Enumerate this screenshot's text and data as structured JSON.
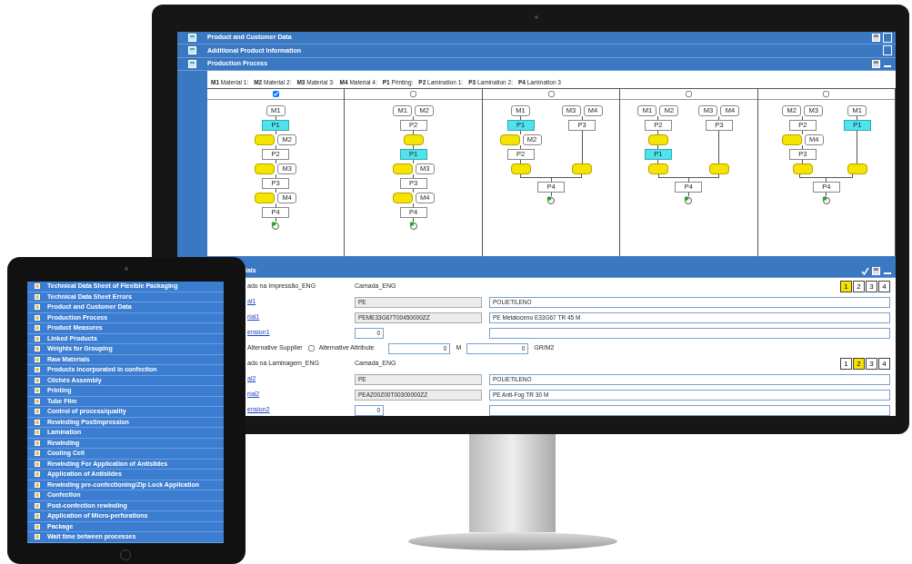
{
  "sections": [
    {
      "title": "Product and Customer Data",
      "expanded": false,
      "savable": true
    },
    {
      "title": "Additional Product Information",
      "expanded": false,
      "savable": false
    },
    {
      "title": "Production Process",
      "expanded": true,
      "savable": true
    }
  ],
  "legend": [
    {
      "code": "M1",
      "name": "Material 1:"
    },
    {
      "code": "M2",
      "name": "Material 2:"
    },
    {
      "code": "M3",
      "name": "Material 3:"
    },
    {
      "code": "M4",
      "name": "Material 4:"
    },
    {
      "code": "P1",
      "name": "Printing:"
    },
    {
      "code": "P2",
      "name": "Lamination 1:"
    },
    {
      "code": "P3",
      "name": "Lamination 2:"
    },
    {
      "code": "P4",
      "name": "Lamination 3"
    }
  ],
  "diagrams": [
    {
      "checked": true,
      "branches": [
        {
          "materials": [
            "M1"
          ],
          "steps": [
            {
              "kind": "printing",
              "label": "P1"
            },
            {
              "kind": "coil",
              "side": "M2"
            },
            {
              "kind": "lamination",
              "label": "P2"
            },
            {
              "kind": "coil",
              "side": "M3"
            },
            {
              "kind": "lamination",
              "label": "P3"
            },
            {
              "kind": "coil",
              "side": "M4"
            },
            {
              "kind": "lamination",
              "label": "P4"
            }
          ]
        }
      ]
    },
    {
      "checked": false,
      "branches": [
        {
          "materials": [
            "M1",
            "M2"
          ],
          "steps": [
            {
              "kind": "lamination",
              "label": "P2"
            },
            {
              "kind": "coil"
            },
            {
              "kind": "printing",
              "label": "P1"
            },
            {
              "kind": "coil",
              "side": "M3"
            },
            {
              "kind": "lamination",
              "label": "P3"
            },
            {
              "kind": "coil",
              "side": "M4"
            },
            {
              "kind": "lamination",
              "label": "P4"
            }
          ]
        }
      ]
    },
    {
      "checked": false,
      "branches": [
        {
          "materials": [
            "M1"
          ],
          "steps": [
            {
              "kind": "printing",
              "label": "P1"
            },
            {
              "kind": "coil",
              "side": "M2"
            },
            {
              "kind": "lamination",
              "label": "P2"
            },
            {
              "kind": "coil"
            }
          ]
        },
        {
          "materials": [
            "M3",
            "M4"
          ],
          "steps": [
            {
              "kind": "lamination",
              "label": "P3"
            },
            {
              "kind": "coil"
            }
          ]
        }
      ],
      "merge": "P4"
    },
    {
      "checked": false,
      "branches": [
        {
          "materials": [
            "M1",
            "M2"
          ],
          "steps": [
            {
              "kind": "lamination",
              "label": "P2"
            },
            {
              "kind": "coil"
            },
            {
              "kind": "printing",
              "label": "P1"
            },
            {
              "kind": "coil"
            }
          ]
        },
        {
          "materials": [
            "M3",
            "M4"
          ],
          "steps": [
            {
              "kind": "lamination",
              "label": "P3"
            },
            {
              "kind": "coil"
            }
          ]
        }
      ],
      "merge": "P4"
    },
    {
      "checked": false,
      "branches": [
        {
          "materials": [
            "M2",
            "M3"
          ],
          "steps": [
            {
              "kind": "lamination",
              "label": "P2"
            },
            {
              "kind": "coil",
              "side": "M4"
            },
            {
              "kind": "lamination",
              "label": "P3"
            },
            {
              "kind": "coil"
            }
          ]
        },
        {
          "materials": [
            "M1"
          ],
          "steps": [
            {
              "kind": "printing",
              "label": "P1"
            },
            {
              "kind": "coil"
            }
          ]
        }
      ],
      "merge": "P4"
    }
  ],
  "materials_section": {
    "title": "ials",
    "expanded": true,
    "savable": true,
    "rows": [
      {
        "kind": "layer",
        "label": "ado na Impressão_ENG",
        "value": "Camada_ENG",
        "pages": [
          {
            "label": "1",
            "selected": true
          },
          {
            "label": "2",
            "selected": false
          },
          {
            "label": "3",
            "selected": false
          },
          {
            "label": "4",
            "selected": false
          }
        ]
      },
      {
        "kind": "pair",
        "link": "al1",
        "code": {
          "value": "PE",
          "readonly": true
        },
        "name": {
          "value": "POLIETILENO",
          "readonly": false
        }
      },
      {
        "kind": "pair",
        "link": "rial1",
        "code": {
          "value": "PEME33G67T00450000ZZ",
          "readonly": true
        },
        "name": {
          "value": "PE Metaloceno E33G67 TR 45 M",
          "readonly": false
        }
      },
      {
        "kind": "dimension",
        "link": "ension1",
        "value": "0"
      },
      {
        "kind": "options",
        "label": "Alternative Supplier",
        "checkbox": {
          "label": "Alternative Attribute",
          "checked": false
        },
        "fields": [
          {
            "value": "0",
            "unit": "M"
          },
          {
            "value": "0",
            "unit": "GR/M2"
          }
        ]
      },
      {
        "kind": "layer",
        "label": "ado na Laminagem_ENG",
        "value": "Camada_ENG",
        "pages": [
          {
            "label": "1",
            "selected": false
          },
          {
            "label": "2",
            "selected": true
          },
          {
            "label": "3",
            "selected": false
          },
          {
            "label": "4",
            "selected": false
          }
        ]
      },
      {
        "kind": "pair",
        "link": "al2",
        "code": {
          "value": "PE",
          "readonly": true
        },
        "name": {
          "value": "POLIETILENO",
          "readonly": false
        }
      },
      {
        "kind": "pair",
        "link": "rial2",
        "code": {
          "value": "PEAZ00Z00T00300000ZZ",
          "readonly": true
        },
        "name": {
          "value": "PE Anti-Fog TR 30 M",
          "readonly": false
        }
      },
      {
        "kind": "dimension",
        "link": "ension2",
        "value": "0"
      }
    ]
  },
  "tablet_menu": [
    "Technical Data Sheet of Flexible Packaging",
    "Technical Data Sheet Errors",
    "Product and Customer Data",
    "Production Process",
    "Product Measures",
    "Linked Products",
    "Weights for Grouping",
    "Raw Materials",
    "Products incorporated in confection",
    "Clichés Assembly",
    "Printing",
    "Tube Film",
    "Control of process/quality",
    "Rewinding Postimpression",
    "Lamination",
    "Rewinding",
    "Cooling Cell",
    "Rewinding For Application of Antislides",
    "Application of Antislides",
    "Rewinding pre-confectioning/Zip Lock Application",
    "Confection",
    "Post-confection rewinding",
    "Application of Micro-perforations",
    "Package",
    "Wait time between processes"
  ]
}
